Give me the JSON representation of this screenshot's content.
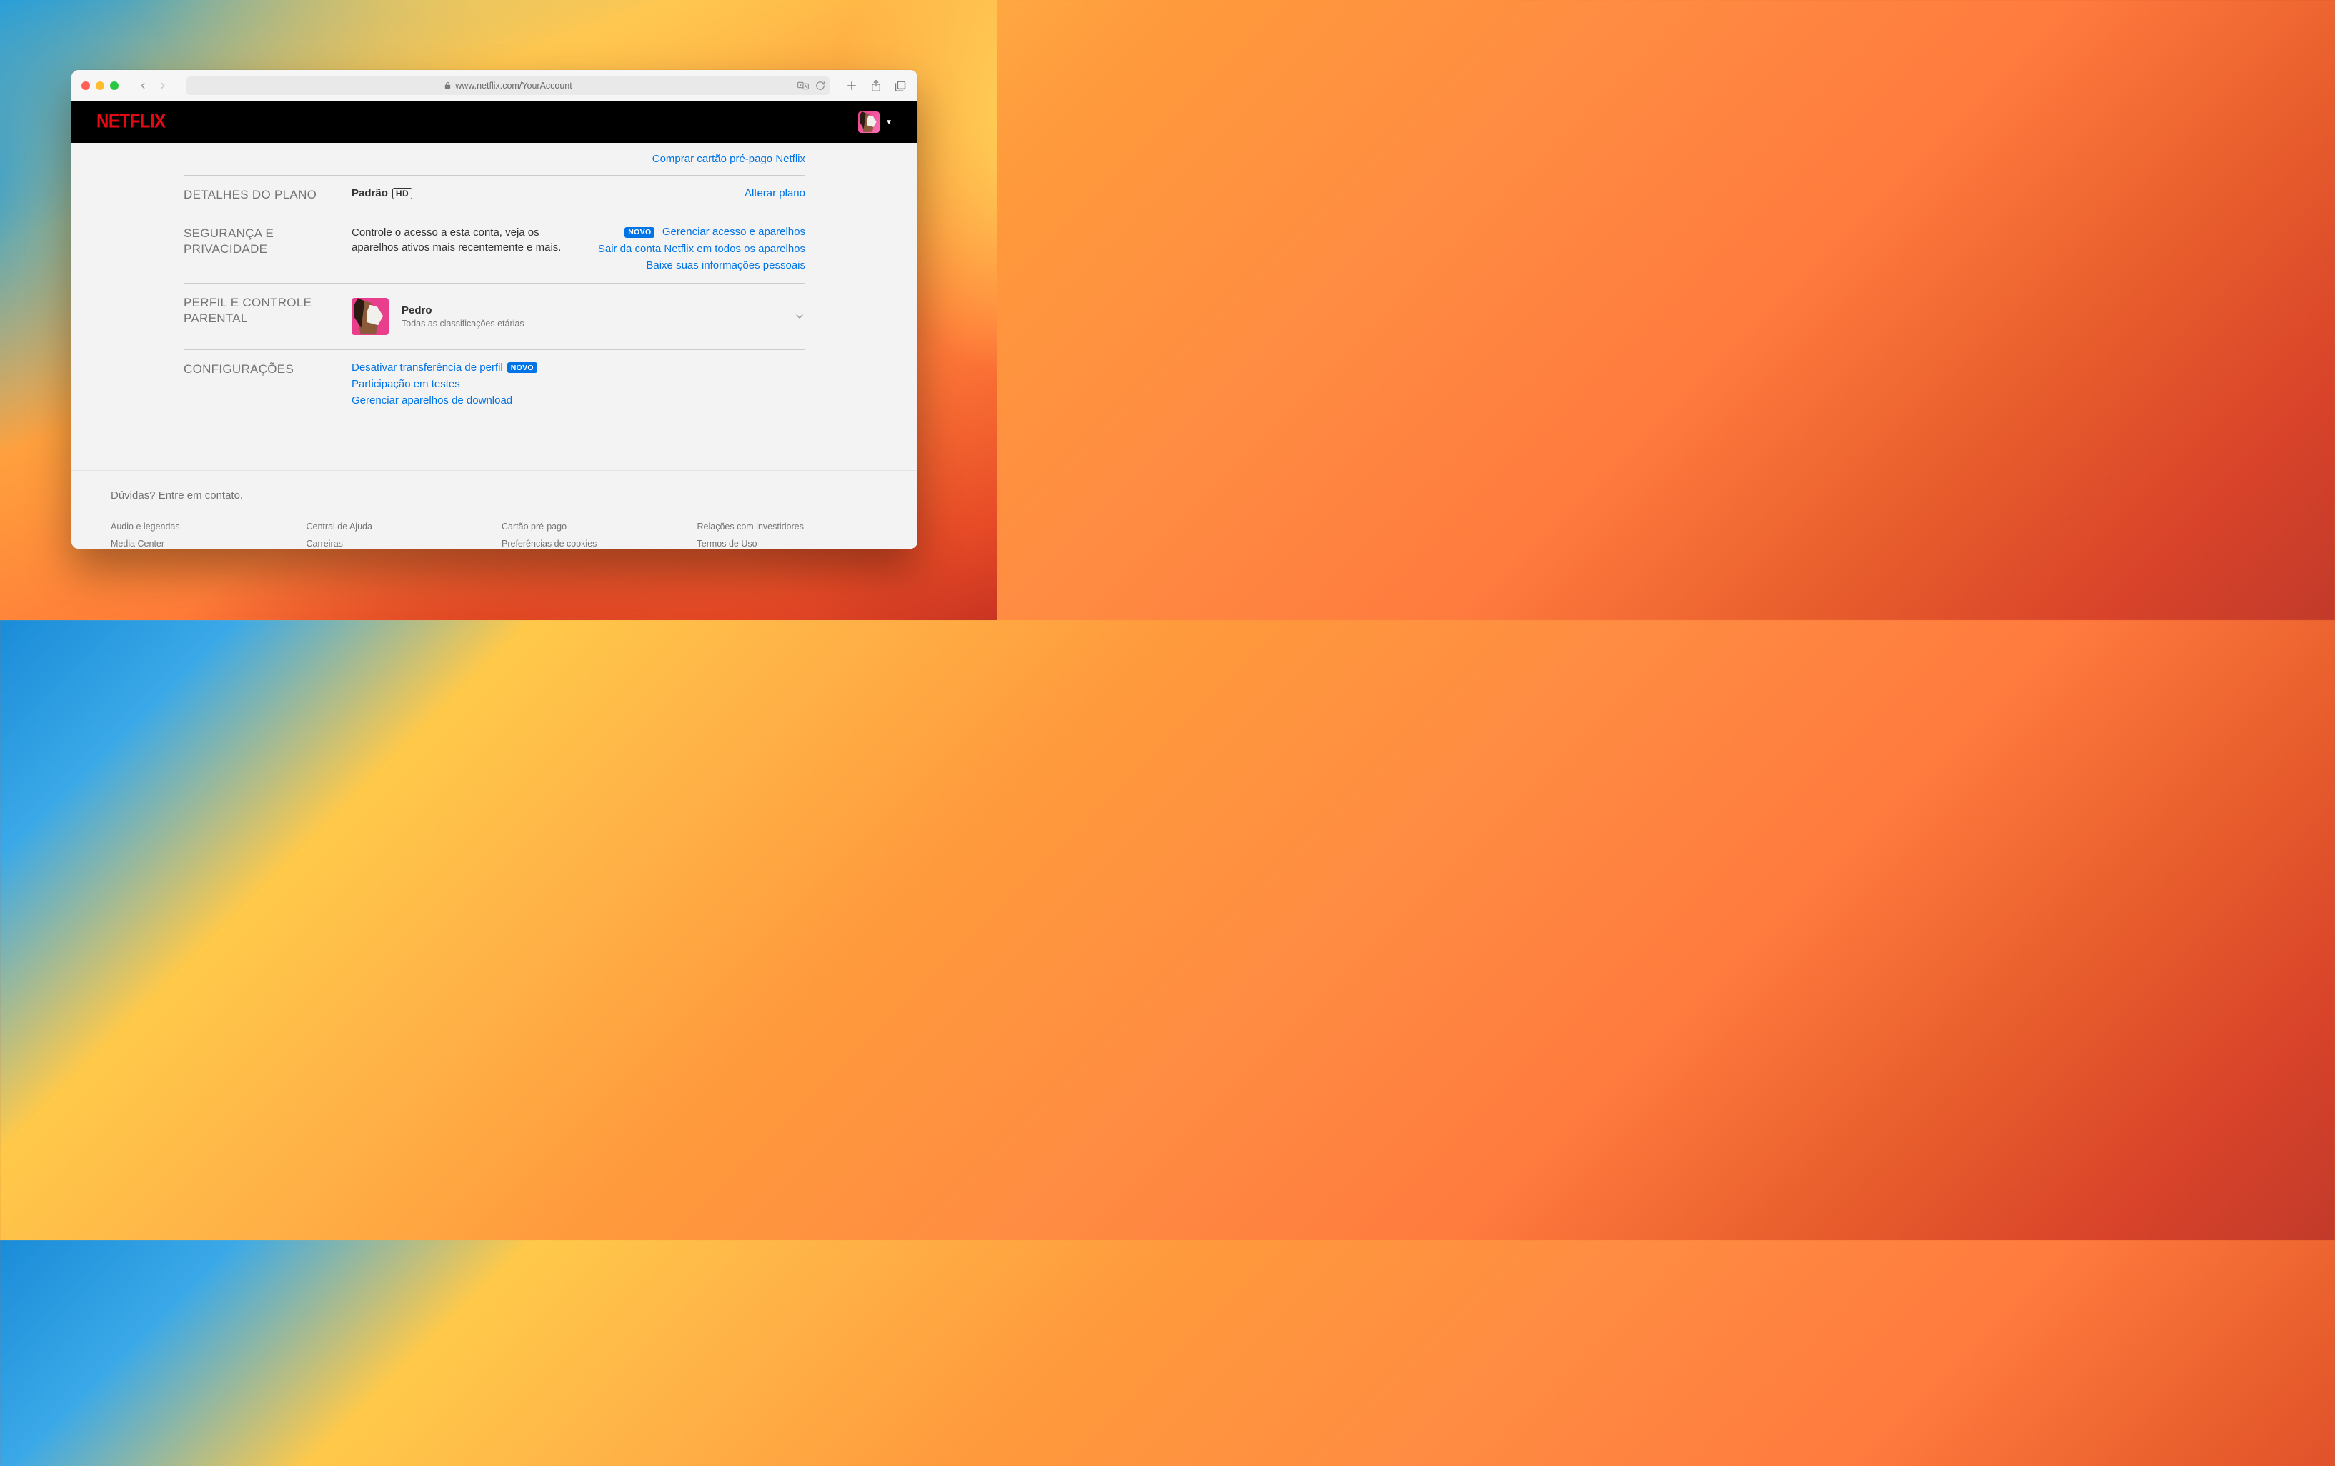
{
  "browser": {
    "url_display": "www.netflix.com/YourAccount"
  },
  "header": {
    "logo": "NETFLIX"
  },
  "toplink": "Comprar cartão pré-pago Netflix",
  "plan": {
    "section_label": "DETALHES DO PLANO",
    "name": "Padrão",
    "badge": "HD",
    "change_link": "Alterar plano"
  },
  "security": {
    "section_label": "SEGURANÇA E PRIVACIDADE",
    "description": "Controle o acesso a esta conta, veja os aparelhos ativos mais recentemente e mais.",
    "novo": "NOVO",
    "links": {
      "manage": "Gerenciar acesso e aparelhos",
      "signout": "Sair da conta Netflix em todos os aparelhos",
      "download": "Baixe suas informações pessoais"
    }
  },
  "profile": {
    "section_label": "PERFIL E CONTROLE PARENTAL",
    "name": "Pedro",
    "sub": "Todas as classificações etárias"
  },
  "settings": {
    "section_label": "CONFIGURAÇÕES",
    "disable_transfer": "Desativar transferência de perfil",
    "novo": "NOVO",
    "tests": "Participação em testes",
    "manage_download": "Gerenciar aparelhos de download"
  },
  "footer": {
    "contact": "Dúvidas? Entre em contato.",
    "col1a": "Áudio e legendas",
    "col1b": "Media Center",
    "col2a": "Central de Ajuda",
    "col2b": "Carreiras",
    "col3a": "Cartão pré-pago",
    "col3b": "Preferências de cookies",
    "col4a": "Relações com investidores",
    "col4b": "Termos de Uso"
  }
}
